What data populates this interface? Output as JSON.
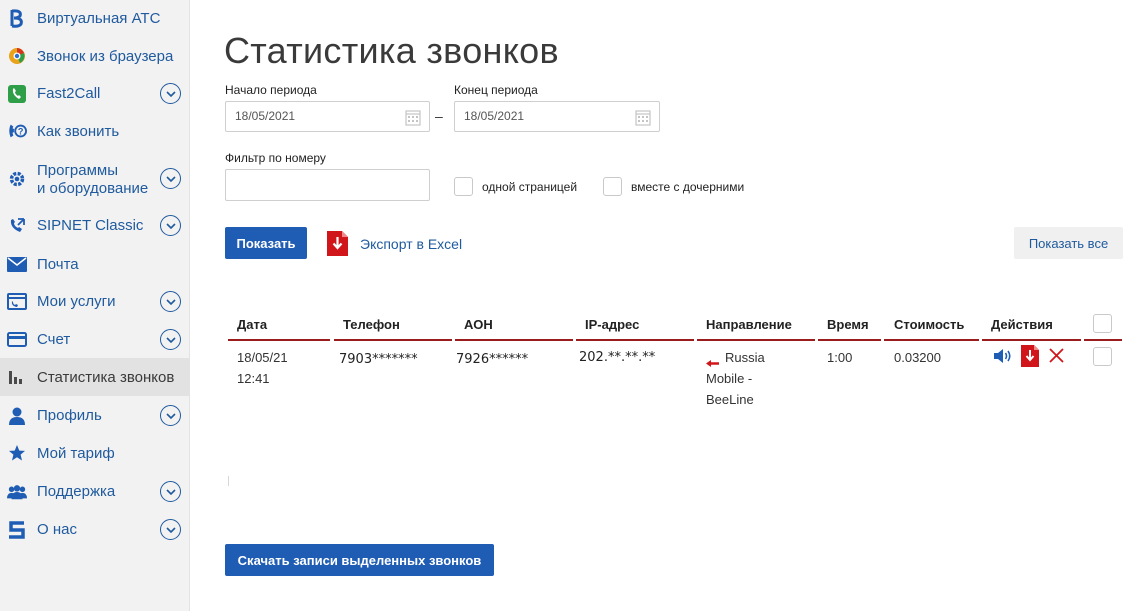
{
  "sidebar": {
    "items": [
      {
        "label": "Виртуальная АТС",
        "icon": "vats-logo-icon",
        "has_chevron": false
      },
      {
        "label": "Звонок из браузера",
        "icon": "browser-call-icon",
        "has_chevron": false
      },
      {
        "label": "Fast2Call",
        "icon": "phone-green-icon",
        "has_chevron": true
      },
      {
        "label": "Как звонить",
        "icon": "how-to-call-icon",
        "has_chevron": false
      },
      {
        "label": "Программы",
        "label2": "и оборудование",
        "icon": "gear-icon",
        "has_chevron": true
      },
      {
        "label": "SIPNET Classic",
        "icon": "phone-call-icon",
        "has_chevron": true
      },
      {
        "label": "Почта",
        "icon": "mail-icon",
        "has_chevron": false
      },
      {
        "label": "Мои услуги",
        "icon": "services-icon",
        "has_chevron": true
      },
      {
        "label": "Счет",
        "icon": "card-icon",
        "has_chevron": true
      },
      {
        "label": "Статистика звонков",
        "icon": "bar-chart-icon",
        "has_chevron": false,
        "active": true
      },
      {
        "label": "Профиль",
        "icon": "user-icon",
        "has_chevron": true
      },
      {
        "label": "Мой тариф",
        "icon": "star-icon",
        "has_chevron": false
      },
      {
        "label": "Поддержка",
        "icon": "group-icon",
        "has_chevron": true
      },
      {
        "label": "О нас",
        "icon": "sipnet-logo-icon",
        "has_chevron": true
      }
    ]
  },
  "main": {
    "title": "Статистика звонков",
    "period_start_label": "Начало периода",
    "period_start_value": "18/05/2021",
    "period_end_label": "Конец периода",
    "period_end_value": "18/05/2021",
    "period_separator": "–",
    "filter_label": "Фильтр по номеру",
    "filter_value": "",
    "single_page_label": "одной страницей",
    "with_children_label": "вместе с дочерними",
    "show_button": "Показать",
    "export_label": "Экспорт в Excel",
    "show_all_button": "Показать все",
    "download_button": "Скачать записи выделенных звонков"
  },
  "table": {
    "headers": [
      "Дата",
      "Телефон",
      "АОН",
      "IP-адрес",
      "Направление",
      "Время",
      "Стоимость",
      "Действия"
    ],
    "rows": [
      {
        "date": "18/05/21",
        "time": "12:41",
        "phone": "7903*******",
        "aon": "7926******",
        "ip": "202.**.**.**",
        "direction_1": "Russia",
        "direction_2": "Mobile -",
        "direction_3": "BeeLine",
        "duration": "1:00",
        "cost": "0.03200"
      }
    ]
  },
  "colors": {
    "link_blue": "#1f5a9e",
    "button_blue": "#1f5cb4",
    "header_rule": "#9b1c1c",
    "action_red": "#d0161b"
  }
}
